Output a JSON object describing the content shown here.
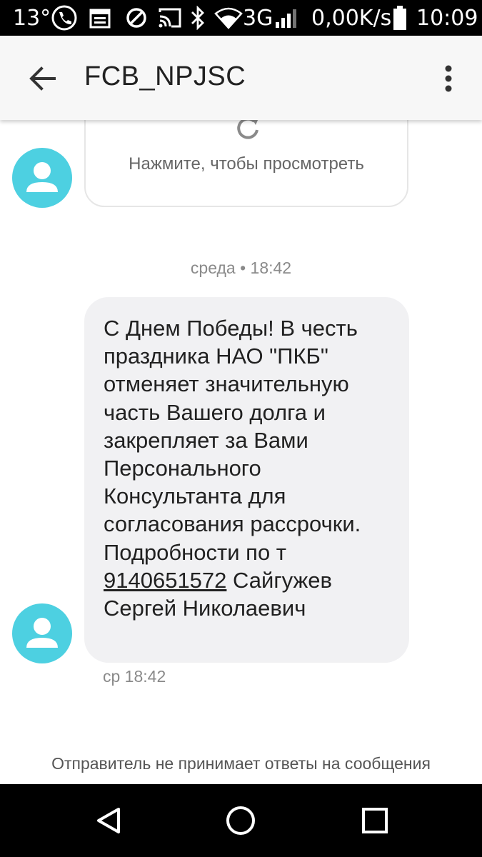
{
  "status_bar": {
    "temperature": "13°",
    "network_type": "3G",
    "speed": "0,00K/s",
    "time": "10:09",
    "icons": [
      "phone-icon",
      "calendar-icon",
      "dnd-icon",
      "cast-icon",
      "bluetooth-icon",
      "wifi-icon",
      "signal-icon",
      "battery-icon"
    ]
  },
  "app_bar": {
    "title": "FCB_NPJSC",
    "back_icon": "arrow-back-icon",
    "overflow_icon": "more-vert-icon"
  },
  "conversation": {
    "preview_message": {
      "action_text": "Нажмите, чтобы просмотреть",
      "icon": "refresh-icon"
    },
    "day_separator": "среда • 18:42",
    "message": {
      "text_before_link": "С Днем Победы! В честь праздника НАО \"ПКБ\" отменяет значительную часть Вашего долга и закрепляет за Вами Персонального Консультанта для согласования рассрочки. Подробности по т ",
      "phone_link": "9140651572",
      "text_after_link": " Сайгужев Сергей Николаевич",
      "timestamp": "ср 18:42"
    },
    "no_reply_notice": "Отправитель не принимает ответы на сообщения"
  },
  "colors": {
    "avatar": "#4dd0e1",
    "bubble": "#f1f1f3",
    "app_bar": "#f7f7f7"
  },
  "nav_bar": {
    "icons": [
      "back-triangle-icon",
      "home-circle-icon",
      "recents-square-icon"
    ]
  }
}
